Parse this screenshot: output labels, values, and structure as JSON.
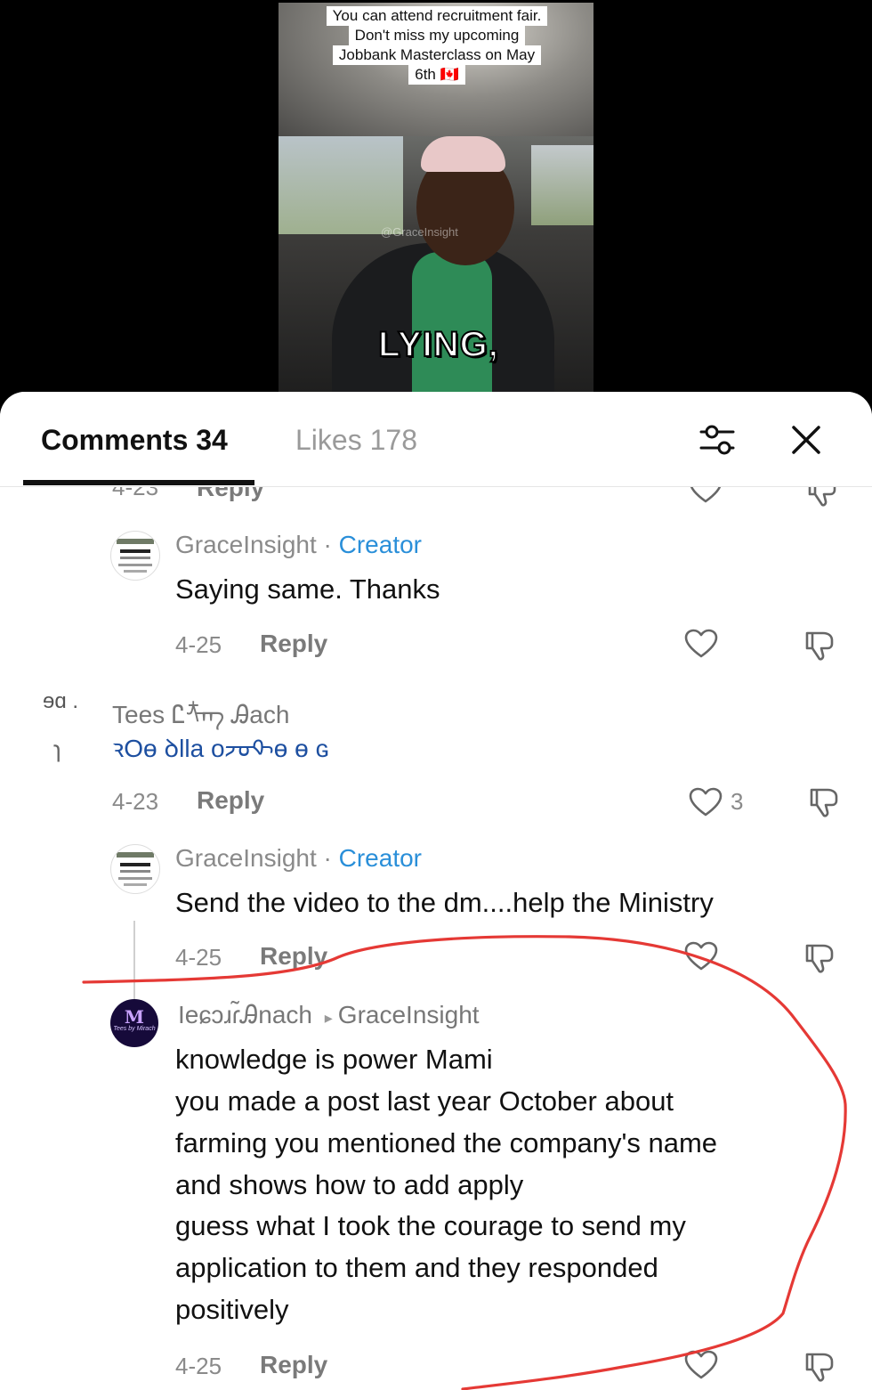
{
  "video": {
    "caption_lines": [
      "You can attend recruitment fair.",
      "Don't miss my upcoming",
      "Jobbank Masterclass on May",
      "6th 🇨🇦"
    ],
    "subtitle": "LYING,",
    "watermark": "@GraceInsight"
  },
  "tabs": {
    "comments": "Comments 34",
    "likes": "Likes 178"
  },
  "icons": {
    "filter": "sliders-icon",
    "close": "close-icon",
    "like": "heart-icon",
    "dislike": "thumbs-down-icon"
  },
  "comments": [
    {
      "partial_date": "4-23",
      "partial_reply": "Reply"
    },
    {
      "user": "GraceInsight",
      "separator": " · ",
      "badge": "Creator",
      "text": "Saying same. Thanks",
      "date": "4-25",
      "reply": "Reply"
    },
    {
      "user_fragment": "ɘɑ .",
      "user": "Tees Ꮭᡮᡢ Ꭿach",
      "text_fragment": "ɿ",
      "text": "ꝛOɵ ꝺlla oᡔᠣᡐɵ ɵ ɢ",
      "date": "4-23",
      "reply": "Reply",
      "likes": "3"
    },
    {
      "user": "GraceInsight",
      "separator": " · ",
      "badge": "Creator",
      "text": "Send the video to the dm....help the Ministry",
      "date": "4-25",
      "reply": "Reply"
    },
    {
      "user": "Ieɕɔɹɾ̃Ꭿnach",
      "reply_to_arrow": "▸",
      "reply_to": "GraceInsight",
      "avatar_text": "M",
      "avatar_sub": "Tees by Mirach",
      "lines": [
        "knowledge is power Mami",
        "you made a post last year October about",
        "farming you mentioned the company's name",
        "and shows how to add apply",
        "guess what I took the courage to send my",
        "application to them and they responded",
        "positively"
      ],
      "date": "4-25",
      "reply": "Reply"
    }
  ],
  "colors": {
    "creator": "#2a8fd9",
    "annotation": "#e53935"
  }
}
